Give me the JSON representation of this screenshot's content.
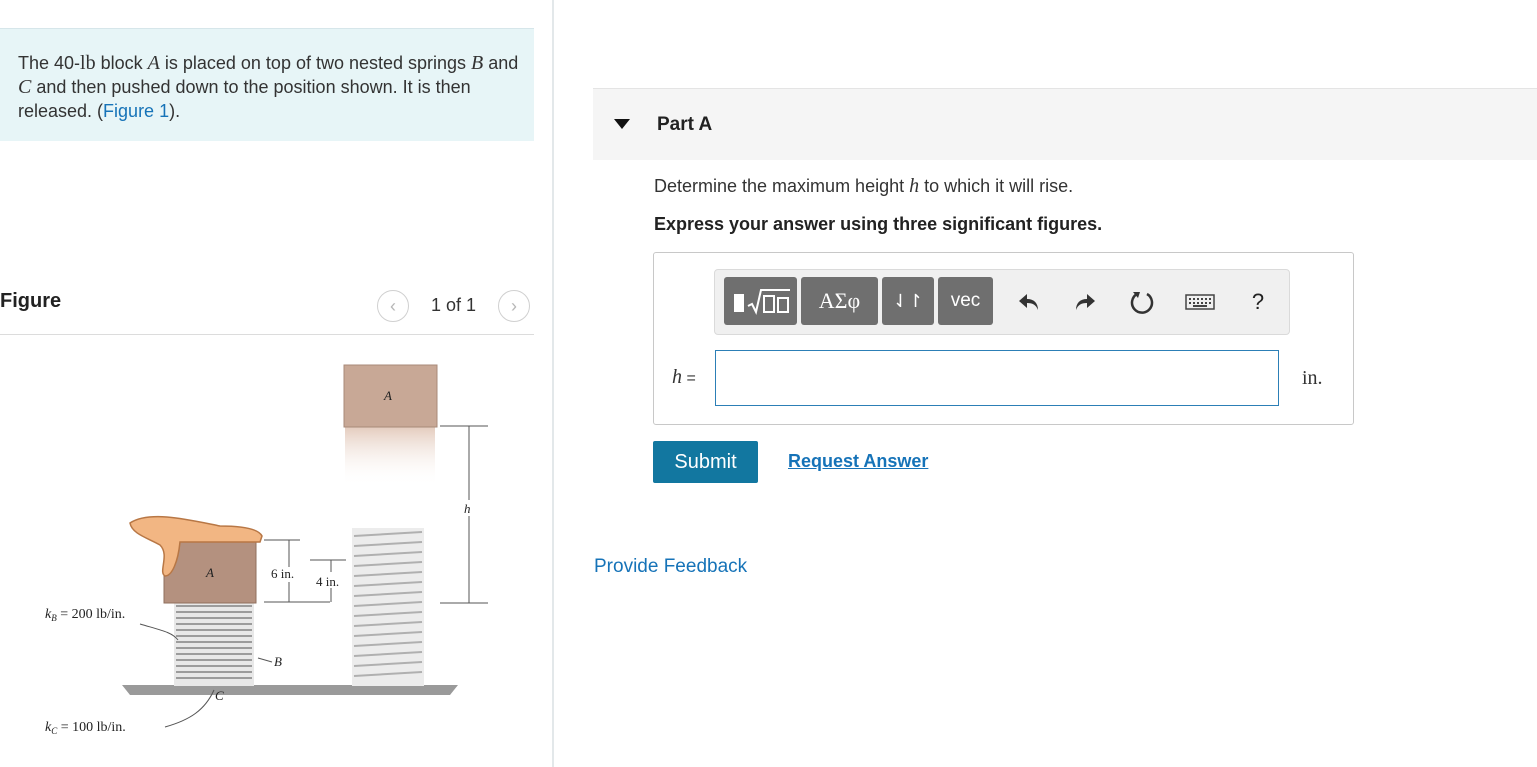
{
  "problem": {
    "t1": "The 40-",
    "t1m": "lb",
    "t2": " block ",
    "t2m": "A",
    "t3": " is placed on top of two nested springs ",
    "t3m": "B",
    "t4": " and ",
    "t4m": "C",
    "t5": " and then pushed down to the position shown. It is then released. (",
    "link": "Figure 1",
    "t6": ")."
  },
  "figure": {
    "title": "Figure",
    "pager": "1 of 1",
    "prev_icon": "chevron-left-icon",
    "next_icon": "chevron-right-icon",
    "labels": {
      "block_a_top": "A",
      "block_a_bottom": "A",
      "h": "h",
      "six_in": "6 in.",
      "four_in": "4 in.",
      "kb": "k",
      "kb_sub": "B",
      "kb_val": " = 200 lb/in.",
      "kc": "k",
      "kc_sub": "C",
      "kc_val": " = 100 lb/in.",
      "spring_b": "B",
      "spring_c": "C"
    },
    "colors": {
      "block": "#c8a896",
      "block_dark": "#a88a78",
      "hand": "#f2b683",
      "spring": "#c8c8c8",
      "ground": "#9a9a9a"
    }
  },
  "part_a": {
    "title": "Part A",
    "q1": "Determine the maximum height ",
    "qm": "h",
    "q2": " to which it will rise.",
    "instruction": "Express your answer using three significant figures.",
    "toolbar": {
      "templates_icon": "templates-icon",
      "greek": "ΑΣφ",
      "arrows": "⇃↾",
      "vec": "vec",
      "undo_icon": "undo-icon",
      "redo_icon": "redo-icon",
      "reset_icon": "reset-icon",
      "keyboard_icon": "keyboard-icon",
      "help": "?"
    },
    "input": {
      "label_var": "h",
      "label_eq": " =",
      "value": "",
      "unit": "in."
    },
    "submit": "Submit",
    "request": "Request Answer"
  },
  "feedback": "Provide Feedback"
}
